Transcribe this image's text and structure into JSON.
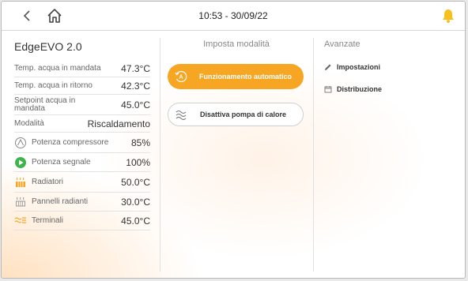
{
  "header": {
    "datetime": "10:53 - 30/09/22",
    "icons": {
      "back": "chevron-left-icon",
      "home": "home-icon",
      "alarm": "bell-icon"
    },
    "alarm_color": "#f6c11f"
  },
  "device": {
    "title": "EdgeEVO 2.0",
    "rows": [
      {
        "label": "Temp. acqua in mandata",
        "value": "47.3°C"
      },
      {
        "label": "Temp. acqua in ritorno",
        "value": "42.3°C"
      },
      {
        "label": "Setpoint acqua in mandata",
        "value": "45.0°C"
      },
      {
        "label": "Modalità",
        "value": "Riscaldamento"
      },
      {
        "label": "Potenza compressore",
        "value": "85%",
        "icon": "compressor-icon"
      },
      {
        "label": "Potenza segnale",
        "value": "100%",
        "icon": "signal-play-icon"
      },
      {
        "label": "Radiatori",
        "value": "50.0°C",
        "icon": "radiator-icon"
      },
      {
        "label": "Pannelli radianti",
        "value": "30.0°C",
        "icon": "radiant-panel-icon"
      },
      {
        "label": "Terminali",
        "value": "45.0°C",
        "icon": "terminal-unit-icon"
      }
    ]
  },
  "mode": {
    "heading": "Imposta modalità",
    "auto_label": "Funzionamento automatico",
    "off_label": "Disattiva pompa di calore"
  },
  "advanced": {
    "heading": "Avanzate",
    "links": [
      {
        "label": "Impostazioni",
        "icon": "pencil-icon"
      },
      {
        "label": "Distribuzione",
        "icon": "calendar-icon"
      }
    ]
  },
  "colors": {
    "accent": "#f6a623",
    "green": "#3cb54a"
  }
}
